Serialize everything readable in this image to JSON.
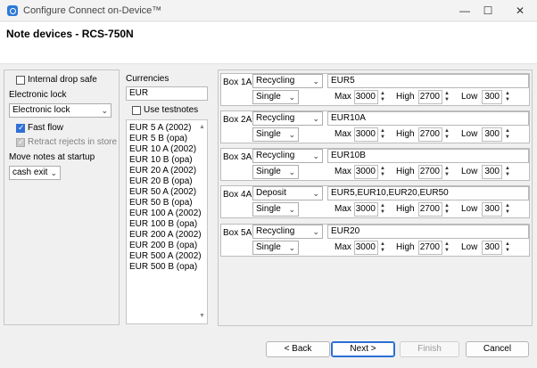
{
  "window": {
    "title": "Configure Connect on-Device™"
  },
  "page": {
    "title": "Note devices  - RCS-750N"
  },
  "left_panel": {
    "internal_drop_safe": "Internal drop safe",
    "electronic_lock_label": "Electronic lock",
    "electronic_lock_value": "Electronic lock",
    "fast_flow": "Fast flow",
    "retract_rejects": "Retract rejects in store",
    "move_notes_label": "Move notes at startup",
    "move_notes_value": "cash exit"
  },
  "currencies": {
    "label": "Currencies",
    "value": "EUR",
    "use_testnotes": "Use testnotes",
    "notes": [
      "EUR 5 A (2002)",
      "EUR 5 B (opa)",
      "EUR 10 A (2002)",
      "EUR 10 B (opa)",
      "EUR 20 A (2002)",
      "EUR 20 B (opa)",
      "EUR 50 A (2002)",
      "EUR 50 B (opa)",
      "EUR 100 A (2002)",
      "EUR 100 B (opa)",
      "EUR 200 A (2002)",
      "EUR 200 B (opa)",
      "EUR 500 A (2002)",
      "EUR 500 B (opa)"
    ]
  },
  "field_labels": {
    "max": "Max",
    "high": "High",
    "low": "Low"
  },
  "boxes": [
    {
      "name": "Box 1A",
      "mode": "Recycling",
      "type": "Single",
      "notes": "EUR5",
      "max": "3000",
      "high": "2700",
      "low": "300"
    },
    {
      "name": "Box 2A",
      "mode": "Recycling",
      "type": "Single",
      "notes": "EUR10A",
      "max": "3000",
      "high": "2700",
      "low": "300"
    },
    {
      "name": "Box 3A",
      "mode": "Recycling",
      "type": "Single",
      "notes": "EUR10B",
      "max": "3000",
      "high": "2700",
      "low": "300"
    },
    {
      "name": "Box 4A",
      "mode": "Deposit",
      "type": "Single",
      "notes": "EUR5,EUR10,EUR20,EUR50",
      "max": "3000",
      "high": "2700",
      "low": "300"
    },
    {
      "name": "Box 5A",
      "mode": "Recycling",
      "type": "Single",
      "notes": "EUR20",
      "max": "3000",
      "high": "2700",
      "low": "300"
    }
  ],
  "buttons": {
    "back": "< Back",
    "next": "Next >",
    "finish": "Finish",
    "cancel": "Cancel"
  },
  "titlebar": {
    "minimize": "—",
    "maximize": "☐",
    "close": "✕"
  }
}
